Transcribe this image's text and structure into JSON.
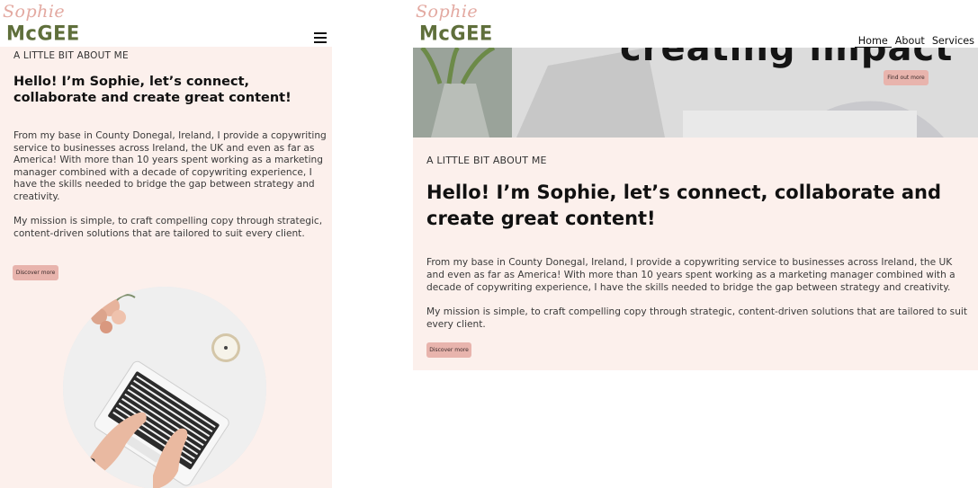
{
  "brand": {
    "script": "Sophie",
    "block": "McGEE",
    "colors": {
      "script": "#e3a9a1",
      "block": "#5f6f3b",
      "section_bg": "#fcf0ec",
      "button_bg": "#e8b4ad"
    }
  },
  "mobile": {
    "menu_icon": "hamburger-icon",
    "eyebrow": "A LITTLE BIT ABOUT ME",
    "heading": "Hello! I’m Sophie, let’s connect, collaborate and create great content!",
    "paragraph1": "From my base in County Donegal, Ireland, I provide a copywriting service to businesses across Ireland, the UK and even as far as America! With more than 10 years spent working as a marketing manager combined with a decade of copywriting experience, I have the skills needed to bridge the gap between strategy and creativity.",
    "paragraph2": "My mission is simple, to craft compelling copy through strategic, content-driven solutions that are tailored to suit every client.",
    "button": "Discover more",
    "image_icon": "laptop-typing-photo"
  },
  "desktop": {
    "nav": [
      "Home",
      "About",
      "Services"
    ],
    "hero_text": "creating impact",
    "hero_button": "Find out more",
    "eyebrow": "A LITTLE BIT ABOUT ME",
    "heading": "Hello! I’m Sophie, let’s connect, collaborate and create great content!",
    "paragraph1": "From my base in County Donegal, Ireland, I provide a copywriting service to businesses across Ireland, the UK and even as far as America! With more than 10 years spent working as a marketing manager combined with a decade of copywriting experience, I have the skills needed to bridge the gap between strategy and creativity.",
    "paragraph2": "My mission is simple, to craft compelling copy through strategic, content-driven solutions that are tailored to suit every client.",
    "button": "Discover more"
  }
}
